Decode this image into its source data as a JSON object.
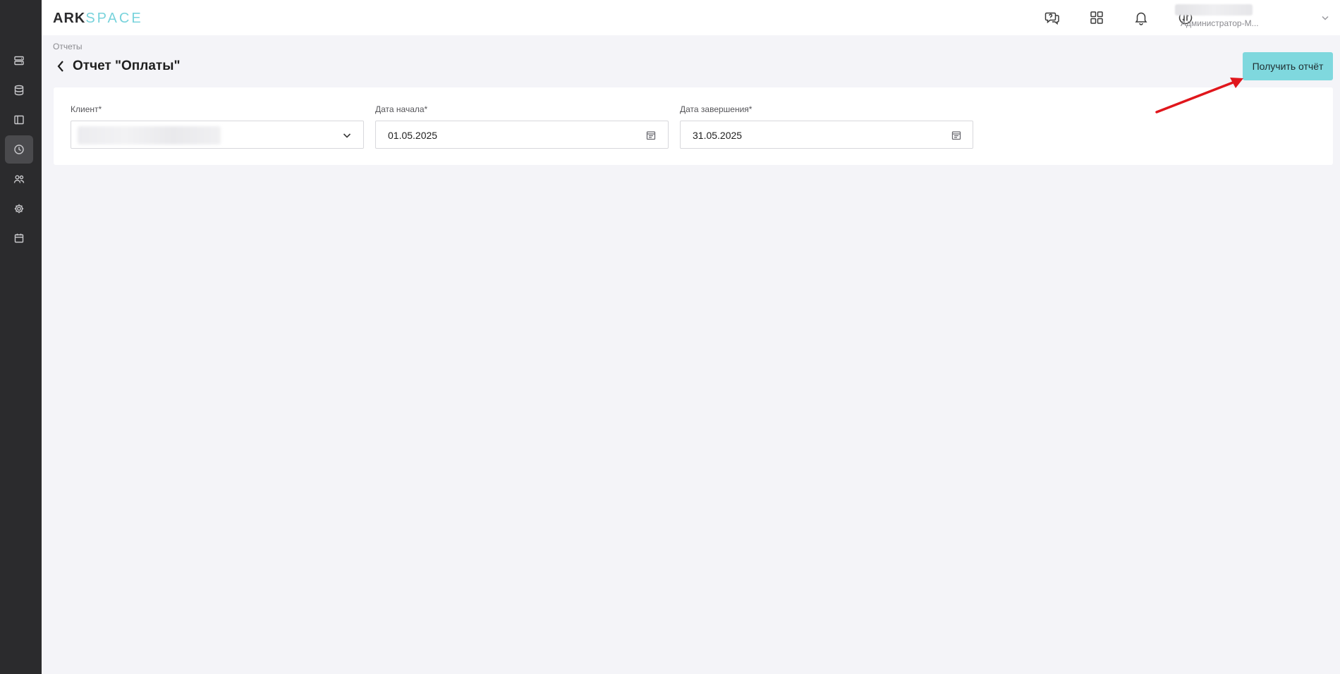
{
  "app": {
    "logo_part1": "ARK",
    "logo_part2": "SPACE",
    "accent_color": "#7fd8de"
  },
  "sidebar": {
    "items": [
      {
        "icon": "server-icon",
        "active": false
      },
      {
        "icon": "database-icon",
        "active": false
      },
      {
        "icon": "layout-icon",
        "active": false
      },
      {
        "icon": "reports-clock-icon",
        "active": true
      },
      {
        "icon": "users-icon",
        "active": false
      },
      {
        "icon": "settings-gear-icon",
        "active": false
      },
      {
        "icon": "calendar-icon",
        "active": false
      }
    ]
  },
  "header": {
    "icons": [
      "support-chat-icon",
      "apps-grid-icon",
      "bell-icon",
      "sync-icon"
    ],
    "user_role": "Администратор-М..."
  },
  "breadcrumb": "Отчеты",
  "page_title": "Отчет \"Оплаты\"",
  "actions": {
    "get_report_label": "Получить отчёт"
  },
  "form": {
    "client": {
      "label": "Клиент*",
      "value": ""
    },
    "start_date": {
      "label": "Дата начала*",
      "value": "01.05.2025"
    },
    "end_date": {
      "label": "Дата завершения*",
      "value": "31.05.2025"
    }
  }
}
